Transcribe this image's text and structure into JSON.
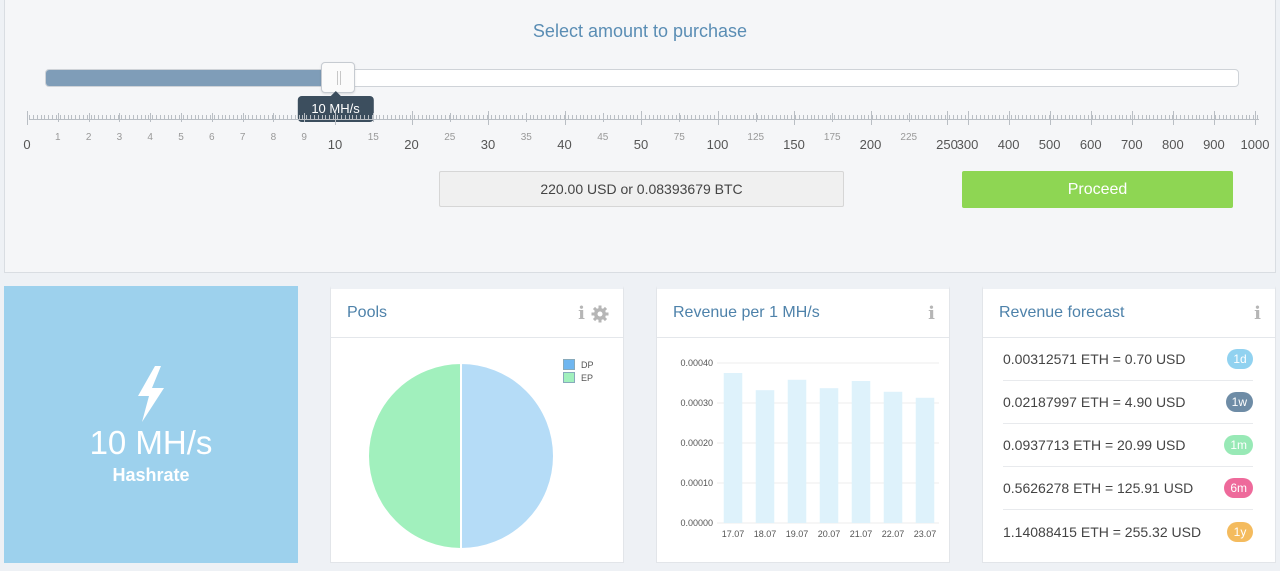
{
  "purchase": {
    "title": "Select amount to purchase",
    "slider_value_label": "10 MH/s",
    "slider_position": 0.245,
    "price_text": "220.00 USD or 0.08393679 BTC",
    "proceed_label": "Proceed",
    "colors": {
      "fill": "#7f9db8",
      "proceed": "#8ed653",
      "tooltip": "#3c4e5e"
    },
    "scale": {
      "major": [
        "0",
        "10",
        "20",
        "30",
        "40",
        "50",
        "100",
        "150",
        "200",
        "250",
        "300",
        "400",
        "500",
        "600",
        "700",
        "800",
        "900",
        "1000"
      ],
      "minor": [
        "1",
        "2",
        "3",
        "4",
        "5",
        "6",
        "7",
        "8",
        "9",
        "15",
        "25",
        "35",
        "45",
        "75",
        "125",
        "175",
        "225"
      ]
    }
  },
  "hashrate": {
    "icon": "bolt-icon",
    "value": "10 MH/s",
    "label": "Hashrate",
    "color": "#9dd1ed"
  },
  "pools": {
    "title": "Pools",
    "info_icon": "i",
    "chart_data": {
      "type": "pie",
      "slices": [
        {
          "name": "DP",
          "value": 50,
          "color": "#b5dcf7"
        },
        {
          "name": "EP",
          "value": 50,
          "color": "#a1f0bd"
        }
      ],
      "legend": "top-right"
    }
  },
  "revenue": {
    "title": "Revenue per 1 MH/s",
    "info_icon": "i",
    "chart_data": {
      "type": "bar",
      "categories": [
        "17.07",
        "18.07",
        "19.07",
        "20.07",
        "21.07",
        "22.07",
        "23.07"
      ],
      "values": [
        0.000375,
        0.000332,
        0.000358,
        0.000337,
        0.000355,
        0.000328,
        0.000313
      ],
      "ylim": [
        0,
        0.0004
      ],
      "yticks": [
        "0.00000",
        "0.00010",
        "0.00020",
        "0.00030",
        "0.00040"
      ],
      "grid": true,
      "color": "#def2fb"
    }
  },
  "forecast": {
    "title": "Revenue forecast",
    "info_icon": "i",
    "items": [
      {
        "text": "0.00312571 ETH = 0.70 USD",
        "badge": "1d",
        "color": "#91d2f0"
      },
      {
        "text": "0.02187997 ETH = 4.90 USD",
        "badge": "1w",
        "color": "#6e8ca6"
      },
      {
        "text": "0.0937713 ETH = 20.99 USD",
        "badge": "1m",
        "color": "#98e9b6"
      },
      {
        "text": "0.5626278 ETH = 125.91 USD",
        "badge": "6m",
        "color": "#ee6a9b"
      },
      {
        "text": "1.14088415 ETH = 255.32 USD",
        "badge": "1y",
        "color": "#f4bb5e"
      }
    ]
  }
}
